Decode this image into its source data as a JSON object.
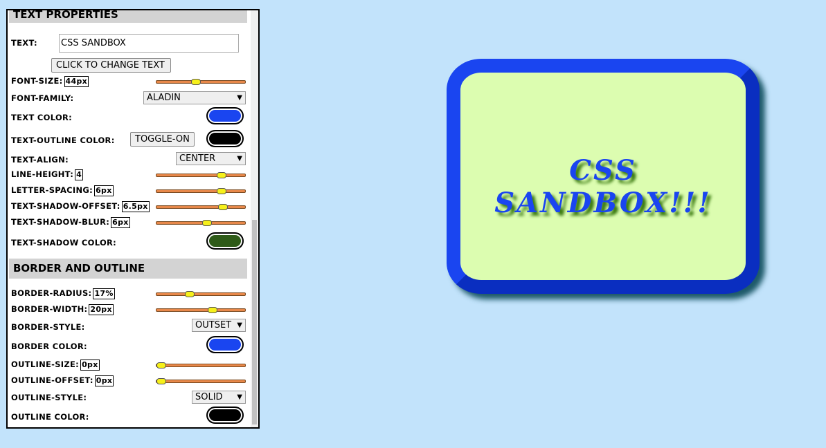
{
  "text_properties": {
    "header": "TEXT PROPERTIES",
    "text_label": "TEXT:",
    "text_value": "CSS SANDBOX",
    "change_button": "CLICK TO CHANGE TEXT",
    "font_size_label": "FONT-SIZE:",
    "font_size_value": "44px",
    "font_size_fraction": 0.44,
    "font_family_label": "FONT-FAMILY:",
    "font_family_value": "ALADIN",
    "text_color_label": "TEXT COLOR:",
    "text_color": "#1a45f0",
    "outline_color_label": "TEXT-OUTLINE COLOR:",
    "toggle_button": "TOGGLE-ON",
    "outline_color": "#000000",
    "text_align_label": "TEXT-ALIGN:",
    "text_align_value": "CENTER",
    "line_height_label": "LINE-HEIGHT:",
    "line_height_value": "4",
    "line_height_fraction": 0.76,
    "letter_spacing_label": "LETTER-SPACING:",
    "letter_spacing_value": "6px",
    "letter_spacing_fraction": 0.76,
    "shadow_offset_label": "TEXT-SHADOW-OFFSET:",
    "shadow_offset_value": "6.5px",
    "shadow_offset_fraction": 0.78,
    "shadow_blur_label": "TEXT-SHADOW-BLUR:",
    "shadow_blur_value": "6px",
    "shadow_blur_fraction": 0.58,
    "shadow_color_label": "TEXT-SHADOW COLOR:",
    "shadow_color": "#2e5a18"
  },
  "border_outline": {
    "header": "BORDER AND OUTLINE",
    "radius_label": "BORDER-RADIUS:",
    "radius_value": "17%",
    "radius_fraction": 0.36,
    "width_label": "BORDER-WIDTH:",
    "width_value": "20px",
    "width_fraction": 0.65,
    "style_label": "BORDER-STYLE:",
    "style_value": "OUTSET",
    "color_label": "BORDER COLOR:",
    "border_color": "#1a45f0",
    "outline_size_label": "OUTLINE-SIZE:",
    "outline_size_value": "0px",
    "outline_size_fraction": 0,
    "outline_offset_label": "OUTLINE-OFFSET:",
    "outline_offset_value": "0px",
    "outline_offset_fraction": 0,
    "outline_style_label": "OUTLINE-STYLE:",
    "outline_style_value": "SOLID",
    "outline_color_label": "OUTLINE COLOR:",
    "outline_color": "#000000"
  },
  "preview": {
    "text": "CSS SANDBOX!!!",
    "background_color": "#dcfdb0",
    "page_background": "#c2e3fb"
  }
}
